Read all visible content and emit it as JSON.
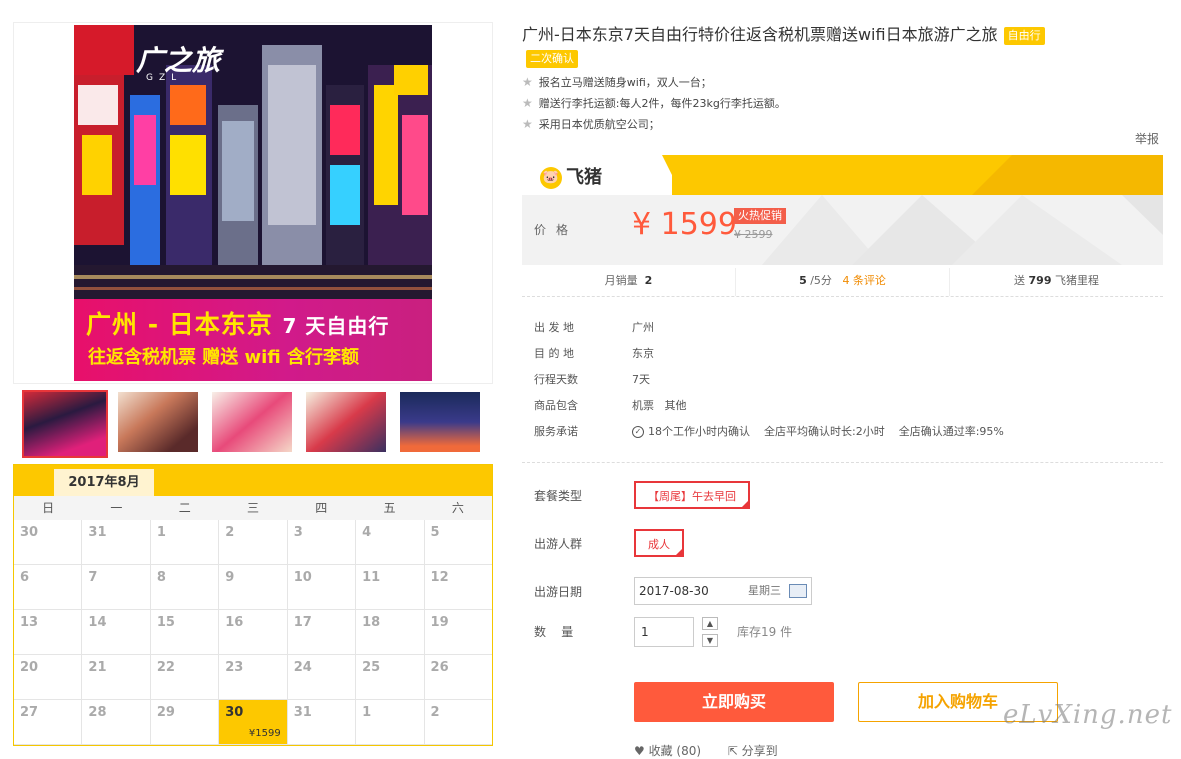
{
  "product": {
    "title": "广州-日本东京7天自由行特价往返含税机票赠送wifi日本旅游广之旅",
    "tag1": "自由行",
    "tag2": "二次确认",
    "features": [
      "报名立马赠送随身wifi，双人一台；",
      "赠送行李托运额:每人2件，每件23kg行李托运额。",
      "采用日本优质航空公司；"
    ],
    "report": "举报"
  },
  "poster": {
    "logo": "广之旅",
    "logo_sub": "GZL",
    "line1_main": "广州 - 日本东京",
    "line1_sub": "7 天自由行",
    "line2": "往返含税机票 赠送 wifi 含行李额"
  },
  "brand": {
    "name": "飞猪",
    "face": "🐷"
  },
  "price": {
    "label": "价格",
    "current": "¥ 1599",
    "promo": "火热促销",
    "original": "¥ 2599"
  },
  "stats": {
    "sales_label": "月销量",
    "sales_value": "2",
    "score_value": "5",
    "score_suffix": "/5分",
    "reviews": "4 条评论",
    "miles_prefix": "送",
    "miles_value": "799",
    "miles_suffix": "飞猪里程"
  },
  "info": [
    {
      "k": "出 发 地",
      "v": "广州"
    },
    {
      "k": "目 的 地",
      "v": "东京"
    },
    {
      "k": "行程天数",
      "v": "7天"
    },
    {
      "k": "商品包含",
      "v": "机票   其他"
    }
  ],
  "service": {
    "label": "服务承诺",
    "items": [
      "18个工作小时内确认",
      "全店平均确认时长:2小时",
      "全店确认通过率:95%"
    ]
  },
  "options": {
    "package_label": "套餐类型",
    "package_value": "【周尾】午去早回",
    "crowd_label": "出游人群",
    "crowd_value": "成人",
    "date_label": "出游日期",
    "date_value": "2017-08-30",
    "date_week": "星期三",
    "qty_label": "数    量",
    "qty_value": "1",
    "stock": "库存19 件"
  },
  "actions": {
    "buy": "立即购买",
    "cart": "加入购物车",
    "fav": "♥ 收藏 (80)",
    "share": "⇱ 分享到"
  },
  "calendar": {
    "month": "2017年8月",
    "weekdays": [
      "日",
      "一",
      "二",
      "三",
      "四",
      "五",
      "六"
    ],
    "weeks": [
      [
        "30",
        "31",
        "1",
        "2",
        "3",
        "4",
        "5"
      ],
      [
        "6",
        "7",
        "8",
        "9",
        "10",
        "11",
        "12"
      ],
      [
        "13",
        "14",
        "15",
        "16",
        "17",
        "18",
        "19"
      ],
      [
        "20",
        "21",
        "22",
        "23",
        "24",
        "25",
        "26"
      ],
      [
        "27",
        "28",
        "29",
        "30",
        "31",
        "1",
        "2"
      ]
    ],
    "selected_price": "¥1599"
  },
  "watermark": "eLvXing.net"
}
